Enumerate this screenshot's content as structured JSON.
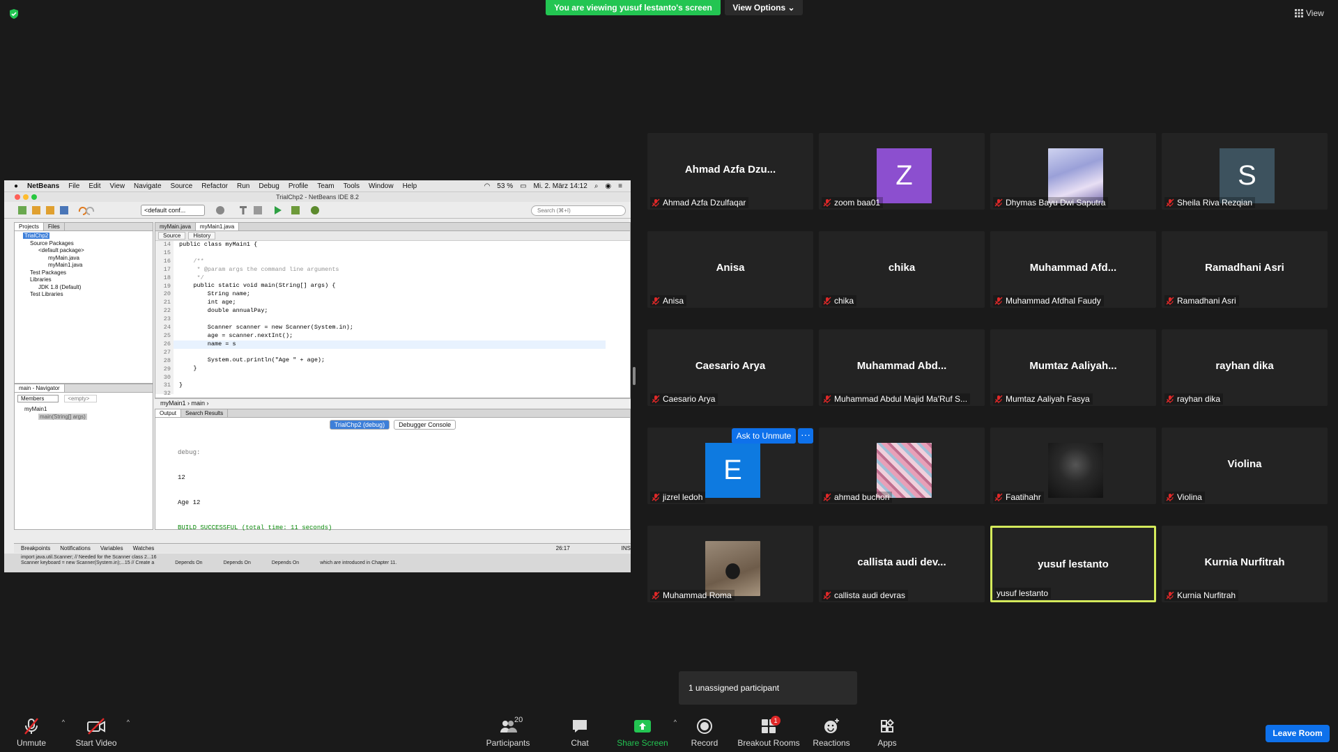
{
  "banner": {
    "text": "You are viewing yusuf lestanto's screen",
    "view_options": "View Options"
  },
  "view_button": "View",
  "shared_screen": {
    "menubar": [
      "NetBeans",
      "File",
      "Edit",
      "View",
      "Navigate",
      "Source",
      "Refactor",
      "Run",
      "Debug",
      "Profile",
      "Team",
      "Tools",
      "Window",
      "Help"
    ],
    "menubar_right": {
      "battery": "53 %",
      "datetime": "Mi. 2. März 14:12"
    },
    "window_title": "TrialChp2 - NetBeans IDE 8.2",
    "config": "<default conf...",
    "search_placeholder": "Search (⌘+I)",
    "project_tabs": [
      "Projects",
      "Files"
    ],
    "tree": [
      "TrialChp2",
      "Source Packages",
      "<default package>",
      "myMain.java",
      "myMain1.java",
      "Test Packages",
      "Libraries",
      "JDK 1.8 (Default)",
      "Test Libraries"
    ],
    "navigator": {
      "title": "main - Navigator",
      "members": "Members",
      "empty": "<empty>",
      "class": "myMain1",
      "method": "main(String[] args)"
    },
    "editor_tabs": [
      "myMain.java",
      "myMain1.java"
    ],
    "source_tabs": [
      "Source",
      "History"
    ],
    "line_numbers": [
      "14",
      "15",
      "16",
      "17",
      "18",
      "19",
      "20",
      "21",
      "22",
      "23",
      "24",
      "25",
      "26",
      "27",
      "28",
      "29",
      "30",
      "31",
      "32"
    ],
    "code_lines": [
      "public class myMain1 {",
      "",
      "    /**",
      "     * @param args the command line arguments",
      "     */",
      "    public static void main(String[] args) {",
      "        String name;",
      "        int age;",
      "        double annualPay;",
      "",
      "        Scanner scanner = new Scanner(System.in);",
      "        age = scanner.nextInt();",
      "        name = s",
      "",
      "        System.out.println(\"Age \" + age);",
      "    }",
      "",
      "}",
      ""
    ],
    "breadcrumb": [
      "myMain1",
      "main"
    ],
    "output_tabs": [
      "Output",
      "Search Results"
    ],
    "output_subtabs": [
      "TrialChp2 (debug)",
      "Debugger Console"
    ],
    "output_lines": [
      "debug:",
      "12",
      "Age 12",
      "BUILD SUCCESSFUL (total time: 11 seconds)"
    ],
    "status_tabs": [
      "Breakpoints",
      "Notifications",
      "Variables",
      "Watches"
    ],
    "cursor_pos": "26:17",
    "ins": "INS",
    "bottom_strip": [
      "import java.util.Scanner; // Needed for the Scanner class 2...16",
      "Scanner keyboard = new Scanner(System.in);...15 // Create a",
      "Depends On",
      "Depends On",
      "Depends On",
      "which are introduced in Chapter 11."
    ]
  },
  "participants": [
    {
      "display": "Ahmad  Azfa  Dzu...",
      "name": "Ahmad Azfa Dzulfaqar",
      "type": "text"
    },
    {
      "display": "Z",
      "name": "zoom baa01",
      "type": "avatar",
      "color": "#8c4fcf"
    },
    {
      "display": "",
      "name": "Dhymas Bayu Dwi Saputra",
      "type": "photo-anime"
    },
    {
      "display": "S",
      "name": "Sheila Riva Rezqian",
      "type": "avatar",
      "color": "#3d525e"
    },
    {
      "display": "Anisa",
      "name": "Anisa",
      "type": "text"
    },
    {
      "display": "chika",
      "name": "chika",
      "type": "text"
    },
    {
      "display": "Muhammad  Afd...",
      "name": "Muhammad Afdhal Faudy",
      "type": "text"
    },
    {
      "display": "Ramadhani Asri",
      "name": "Ramadhani Asri",
      "type": "text"
    },
    {
      "display": "Caesario Arya",
      "name": "Caesario Arya",
      "type": "text"
    },
    {
      "display": "Muhammad  Abd...",
      "name": "Muhammad Abdul Majid Ma'Ruf S...",
      "type": "text"
    },
    {
      "display": "Mumtaz  Aaliyah...",
      "name": "Mumtaz Aaliyah Fasya",
      "type": "text"
    },
    {
      "display": "rayhan dika",
      "name": "rayhan dika",
      "type": "text"
    },
    {
      "display": "E",
      "name": "jizrel ledoh",
      "type": "avatar",
      "color": "#0e7ae0"
    },
    {
      "display": "",
      "name": "ahmad buchori",
      "type": "photo-collage"
    },
    {
      "display": "",
      "name": "Faatihahr",
      "type": "photo-dark"
    },
    {
      "display": "Violina",
      "name": "Violina",
      "type": "text"
    },
    {
      "display": "",
      "name": "Muhammad Roma",
      "type": "photo-person"
    },
    {
      "display": "callista audi dev...",
      "name": "callista audi devras",
      "type": "text"
    },
    {
      "display": "yusuf lestanto",
      "name": "yusuf lestanto",
      "type": "text",
      "active": true
    },
    {
      "display": "Kurnia Nurfitrah",
      "name": "Kurnia Nurfitrah",
      "type": "text"
    }
  ],
  "ask_to_unmute": "Ask to Unmute",
  "unassigned_popup": "1 unassigned participant",
  "bottom_bar": {
    "unmute": "Unmute",
    "start_video": "Start Video",
    "participants": "Participants",
    "participant_count": "20",
    "chat": "Chat",
    "share_screen": "Share Screen",
    "record": "Record",
    "breakout_rooms": "Breakout Rooms",
    "breakout_badge": "1",
    "reactions": "Reactions",
    "apps": "Apps",
    "leave_room": "Leave Room"
  },
  "colors": {
    "share_green": "#23c552",
    "zoom_blue": "#0e71eb",
    "active_speaker": "#d4ea5b",
    "mute_red": "#e02828"
  }
}
